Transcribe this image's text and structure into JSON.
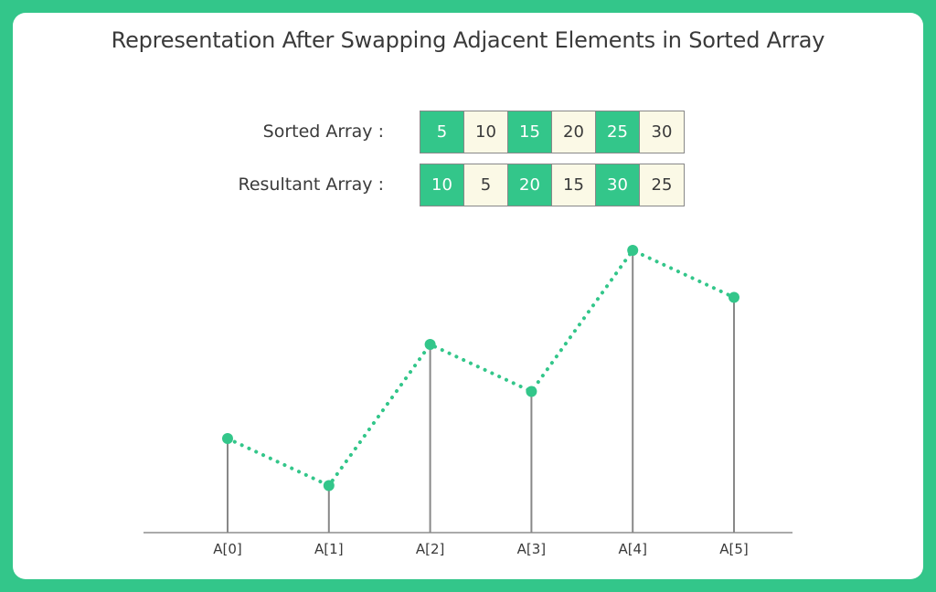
{
  "chart_data": {
    "type": "line",
    "title": "Representation After Swapping Adjacent Elements in Sorted Array",
    "categories": [
      "A[0]",
      "A[1]",
      "A[2]",
      "A[3]",
      "A[4]",
      "A[5]"
    ],
    "values": [
      10,
      5,
      20,
      15,
      30,
      25
    ],
    "xlabel": "",
    "ylabel": "",
    "ylim": [
      0,
      30
    ],
    "grid": false,
    "style": "dotted-line with stems",
    "colors": {
      "accent": "#33c68a",
      "stem": "#888888",
      "cell_alt": "#fbf9e6"
    }
  },
  "arrays": [
    {
      "label": "Sorted Array :",
      "values": [
        "5",
        "10",
        "15",
        "20",
        "25",
        "30"
      ]
    },
    {
      "label": "Resultant Array :",
      "values": [
        "10",
        "5",
        "20",
        "15",
        "30",
        "25"
      ]
    }
  ]
}
